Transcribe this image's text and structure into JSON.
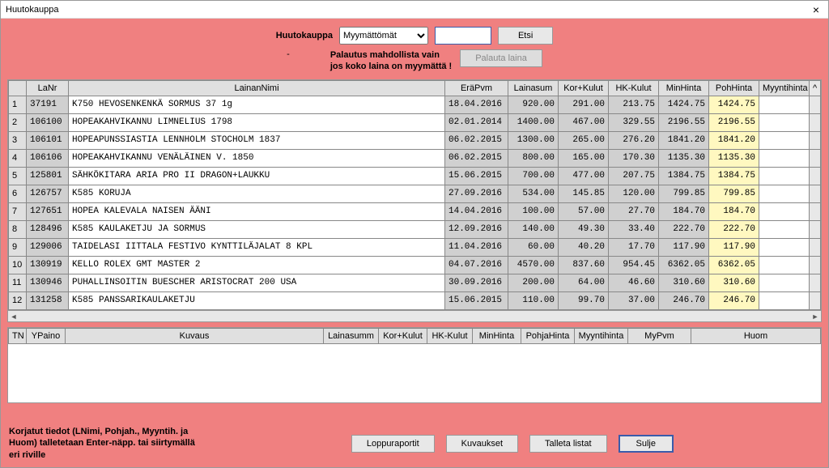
{
  "window": {
    "title": "Huutokauppa"
  },
  "top": {
    "label": "Huutokauppa",
    "dropdown": "Myymättömät",
    "search_btn": "Etsi",
    "marker": "-",
    "warn_line1": "Palautus mahdollista vain",
    "warn_line2": "jos koko laina on myymättä !",
    "return_btn": "Palauta laina"
  },
  "table1": {
    "headers": [
      "",
      "LaNr",
      "LainanNimi",
      "EräPvm",
      "Lainasum",
      "Kor+Kulut",
      "HK-Kulut",
      "MinHinta",
      "PohHinta",
      "Myyntihinta"
    ],
    "rows": [
      {
        "n": "1",
        "id": "37191",
        "name": "K750 HEVOSENKENKÄ SORMUS        37  1g",
        "date": "18.04.2016",
        "sum": "920.00",
        "kk": "291.00",
        "hk": "213.75",
        "min": "1424.75",
        "poh": "1424.75",
        "my": ""
      },
      {
        "n": "2",
        "id": "106100",
        "name": "HOPEAKAHVIKANNU LIMNELIUS 1798",
        "date": "02.01.2014",
        "sum": "1400.00",
        "kk": "467.00",
        "hk": "329.55",
        "min": "2196.55",
        "poh": "2196.55",
        "my": ""
      },
      {
        "n": "3",
        "id": "106101",
        "name": "HOPEAPUNSSIASTIA LENNHOLM STOCHOLM 1837",
        "date": "06.02.2015",
        "sum": "1300.00",
        "kk": "265.00",
        "hk": "276.20",
        "min": "1841.20",
        "poh": "1841.20",
        "my": ""
      },
      {
        "n": "4",
        "id": "106106",
        "name": "HOPEAKAHVIKANNU VENÄLÄINEN V. 1850",
        "date": "06.02.2015",
        "sum": "800.00",
        "kk": "165.00",
        "hk": "170.30",
        "min": "1135.30",
        "poh": "1135.30",
        "my": ""
      },
      {
        "n": "5",
        "id": "125801",
        "name": "SÄHKÖKITARA ARIA PRO II DRAGON+LAUKKU",
        "date": "15.06.2015",
        "sum": "700.00",
        "kk": "477.00",
        "hk": "207.75",
        "min": "1384.75",
        "poh": "1384.75",
        "my": ""
      },
      {
        "n": "6",
        "id": "126757",
        "name": "K585 KORUJA",
        "date": "27.09.2016",
        "sum": "534.00",
        "kk": "145.85",
        "hk": "120.00",
        "min": "799.85",
        "poh": "799.85",
        "my": ""
      },
      {
        "n": "7",
        "id": "127651",
        "name": "HOPEA KALEVALA NAISEN ÄÄNI",
        "date": "14.04.2016",
        "sum": "100.00",
        "kk": "57.00",
        "hk": "27.70",
        "min": "184.70",
        "poh": "184.70",
        "my": ""
      },
      {
        "n": "8",
        "id": "128496",
        "name": "K585 KAULAKETJU JA SORMUS",
        "date": "12.09.2016",
        "sum": "140.00",
        "kk": "49.30",
        "hk": "33.40",
        "min": "222.70",
        "poh": "222.70",
        "my": ""
      },
      {
        "n": "9",
        "id": "129006",
        "name": "TAIDELASI IITTALA FESTIVO KYNTTILÄJALAT 8 KPL",
        "date": "11.04.2016",
        "sum": "60.00",
        "kk": "40.20",
        "hk": "17.70",
        "min": "117.90",
        "poh": "117.90",
        "my": ""
      },
      {
        "n": "10",
        "id": "130919",
        "name": "KELLO ROLEX GMT MASTER 2",
        "date": "04.07.2016",
        "sum": "4570.00",
        "kk": "837.60",
        "hk": "954.45",
        "min": "6362.05",
        "poh": "6362.05",
        "my": ""
      },
      {
        "n": "11",
        "id": "130946",
        "name": "PUHALLINSOITIN BUESCHER ARISTOCRAT 200 USA",
        "date": "30.09.2016",
        "sum": "200.00",
        "kk": "64.00",
        "hk": "46.60",
        "min": "310.60",
        "poh": "310.60",
        "my": ""
      },
      {
        "n": "12",
        "id": "131258",
        "name": "K585 PANSSARIKAULAKETJU",
        "date": "15.06.2015",
        "sum": "110.00",
        "kk": "99.70",
        "hk": "37.00",
        "min": "246.70",
        "poh": "246.70",
        "my": ""
      }
    ]
  },
  "table2": {
    "headers": [
      "TN",
      "YPaino",
      "Kuvaus",
      "Lainasumm",
      "Kor+Kulut",
      "HK-Kulut",
      "MinHinta",
      "PohjaHinta",
      "Myyntihinta",
      "MyPvm",
      "Huom"
    ]
  },
  "footer": {
    "note_l1": "Korjatut tiedot (LNimi, Pohjah., Myyntih. ja",
    "note_l2": "Huom) talletetaan Enter-näpp. tai siirtymällä",
    "note_l3": "eri riville",
    "btn_report": "Loppuraportit",
    "btn_desc": "Kuvaukset",
    "btn_save": "Talleta listat",
    "btn_close": "Sulje"
  }
}
